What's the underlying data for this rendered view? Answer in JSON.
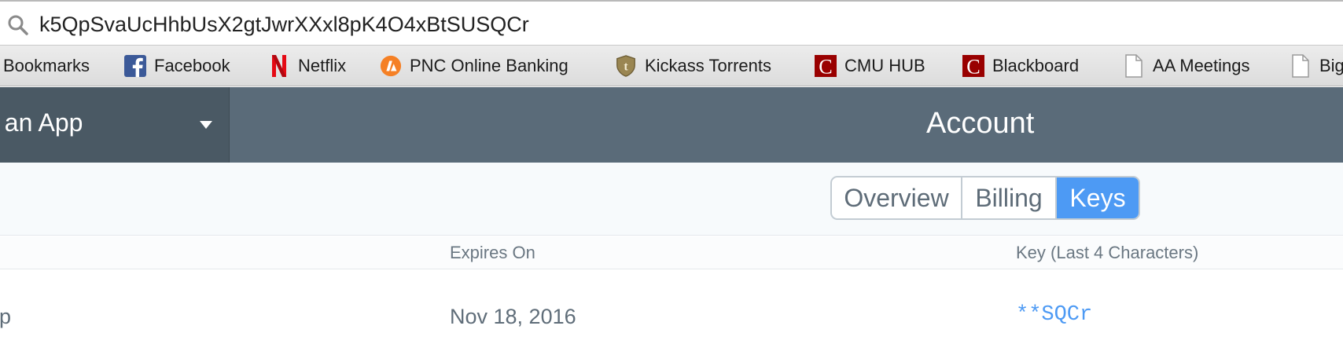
{
  "address_bar": {
    "url": "k5QpSvaUcHhbUsX2gtJwrXXxl8pK4O4xBtSUSQCr"
  },
  "bookmarks": [
    {
      "label": "Bookmarks",
      "icon": "none"
    },
    {
      "label": "Facebook",
      "icon": "facebook-icon"
    },
    {
      "label": "Netflix",
      "icon": "netflix-icon"
    },
    {
      "label": "PNC Online Banking",
      "icon": "pnc-icon"
    },
    {
      "label": "Kickass Torrents",
      "icon": "kickass-icon"
    },
    {
      "label": "CMU HUB",
      "icon": "cmu-icon"
    },
    {
      "label": "Blackboard",
      "icon": "cmu-icon"
    },
    {
      "label": "AA Meetings",
      "icon": "page-icon"
    },
    {
      "label": "Big",
      "icon": "page-icon"
    }
  ],
  "app_header": {
    "app_select_label": "ct an App",
    "title": "Account"
  },
  "tabs": [
    {
      "label": "Overview",
      "active": false
    },
    {
      "label": "Billing",
      "active": false
    },
    {
      "label": "Keys",
      "active": true
    }
  ],
  "table": {
    "columns": [
      "Expires On",
      "Key (Last 4 Characters)"
    ],
    "rows": [
      {
        "app": "pp",
        "expires": "Nov 18, 2016",
        "key": "**SQCr"
      }
    ]
  },
  "colors": {
    "header_bg": "#5a6b79",
    "app_select_bg": "#4a5964",
    "accent": "#4d9af4",
    "text_muted": "#6a7782"
  }
}
